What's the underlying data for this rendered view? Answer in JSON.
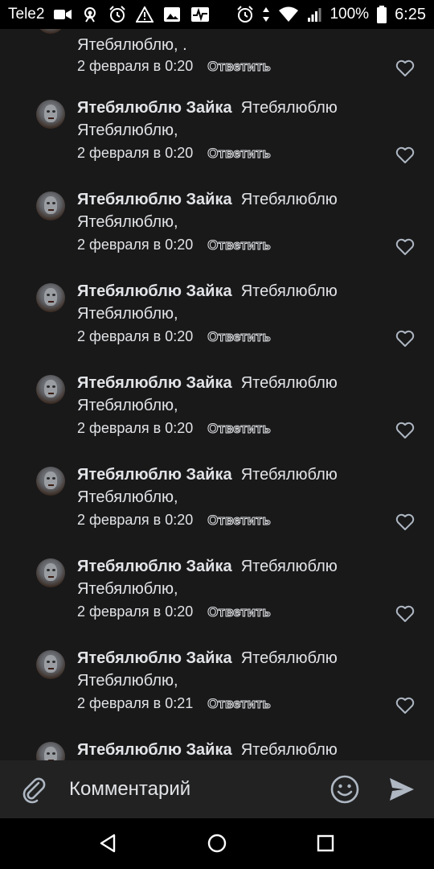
{
  "status_bar": {
    "carrier": "Tele2",
    "battery": "100%",
    "time": "6:25"
  },
  "comments": [
    {
      "author": "",
      "text": "Ятебялюблю, .",
      "date": "2 февраля в 0:20",
      "reply": "Ответить"
    },
    {
      "author": "Ятебялюблю Зайка",
      "text": "Ятебялюблю Ятебялюблю,",
      "date": "2 февраля в 0:20",
      "reply": "Ответить"
    },
    {
      "author": "Ятебялюблю Зайка",
      "text": "Ятебялюблю Ятебялюблю,",
      "date": "2 февраля в 0:20",
      "reply": "Ответить"
    },
    {
      "author": "Ятебялюблю Зайка",
      "text": "Ятебялюблю Ятебялюблю,",
      "date": "2 февраля в 0:20",
      "reply": "Ответить"
    },
    {
      "author": "Ятебялюблю Зайка",
      "text": "Ятебялюблю Ятебялюблю,",
      "date": "2 февраля в 0:20",
      "reply": "Ответить"
    },
    {
      "author": "Ятебялюблю Зайка",
      "text": "Ятебялюблю Ятебялюблю,",
      "date": "2 февраля в 0:20",
      "reply": "Ответить"
    },
    {
      "author": "Ятебялюблю Зайка",
      "text": "Ятебялюблю Ятебялюблю,",
      "date": "2 февраля в 0:20",
      "reply": "Ответить"
    },
    {
      "author": "Ятебялюблю Зайка",
      "text": "Ятебялюблю Ятебялюблю,",
      "date": "2 февраля в 0:21",
      "reply": "Ответить"
    },
    {
      "author": "Ятебялюблю Зайка",
      "text": "Ятебялюблю",
      "date": "",
      "reply": ""
    }
  ],
  "composer": {
    "placeholder": "Комментарий"
  },
  "icons": {
    "attach": "paperclip-icon",
    "emoji": "emoji-icon",
    "send": "send-icon",
    "like": "heart-icon"
  }
}
